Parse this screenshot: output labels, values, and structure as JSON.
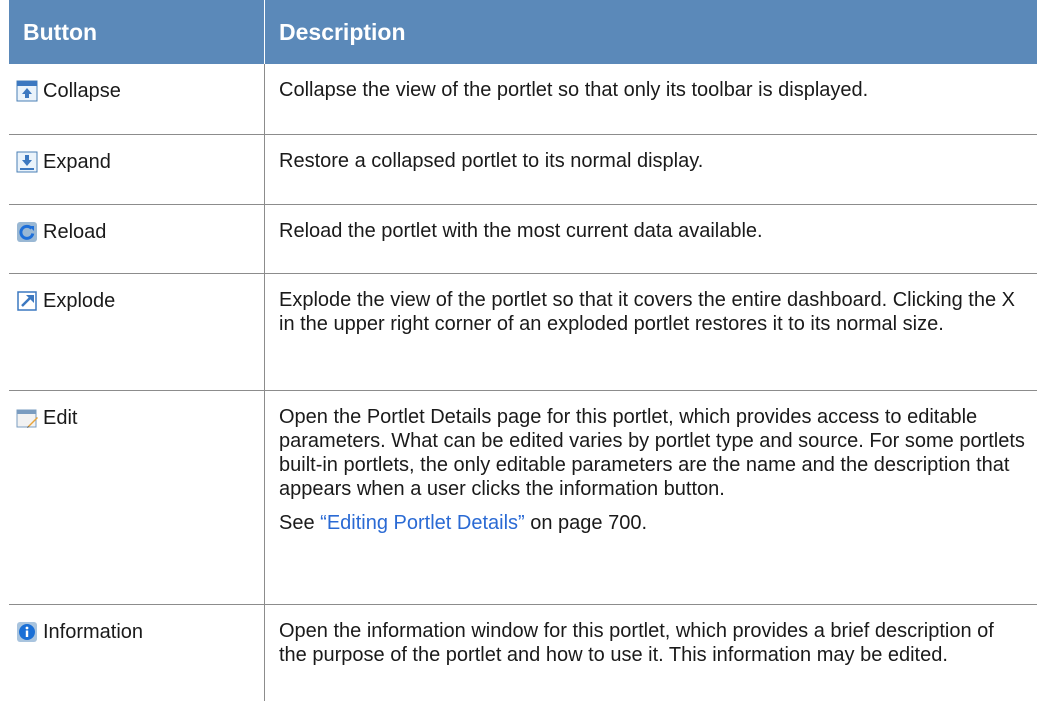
{
  "header": {
    "button_col": "Button",
    "description_col": "Description"
  },
  "rows": [
    {
      "icon": "collapse-icon",
      "button": "Collapse",
      "description": "Collapse the view of the portlet so that only its toolbar is displayed."
    },
    {
      "icon": "expand-icon",
      "button": "Expand",
      "description": "Restore a collapsed portlet to its normal display."
    },
    {
      "icon": "reload-icon",
      "button": "Reload",
      "description": "Reload the portlet with the most current data available."
    },
    {
      "icon": "explode-icon",
      "button": "Explode",
      "description": "Explode the view of the portlet so that it covers the entire dashboard. Clicking the X in the upper right corner of an exploded portlet restores it to its normal size."
    },
    {
      "icon": "edit-icon",
      "button": "Edit",
      "description": "Open the Portlet Details page for this portlet, which provides access to editable parameters. What can be edited varies by portlet type and source. For some portlets built-in portlets, the only editable parameters are the name and the description that appears when a user clicks the information button.",
      "see_prefix": "See ",
      "see_link": "“Editing Portlet Details”",
      "see_suffix": " on page 700."
    },
    {
      "icon": "information-icon",
      "button": "Information",
      "description": "Open the information window for this portlet, which provides a brief description of the purpose of the portlet and how to use it. This information may be edited."
    }
  ],
  "colors": {
    "header_bg": "#5b89b9",
    "link": "#2a6ad4"
  }
}
